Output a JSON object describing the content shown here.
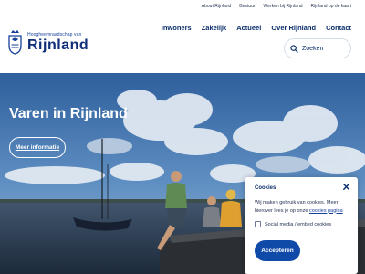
{
  "utility_nav": [
    "About Rijnland",
    "Bestuur",
    "Werken bij Rijnland",
    "Rijnland op de kaart"
  ],
  "logo": {
    "small": "Hoogheemraadschap van",
    "big": "Rijnland"
  },
  "main_nav": [
    "Inwoners",
    "Zakelijk",
    "Actueel",
    "Over Rijnland",
    "Contact"
  ],
  "search": {
    "placeholder": "Zoeken",
    "icon": "search-icon"
  },
  "hero": {
    "title": "Varen in Rijnland",
    "button_label": "Meer informatie"
  },
  "cookie_banner": {
    "title": "Cookies",
    "text_before_link": "Wij maken gebruik van cookies. Meer hierover lees je op onze ",
    "link_label": "cookies pagina",
    "checkbox_label": "Social media / embed cookies",
    "checkbox_checked": false,
    "accept_label": "Accepteren",
    "close_icon": "close-icon"
  },
  "colors": {
    "brand_blue": "#0f4aa8",
    "nav_text": "#0b2f6b",
    "white": "#ffffff"
  }
}
